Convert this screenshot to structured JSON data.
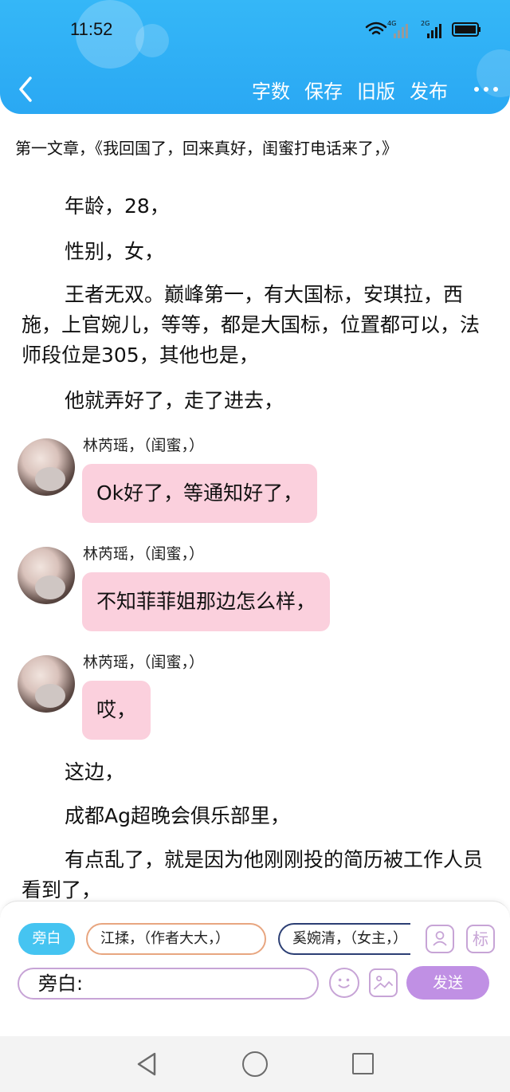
{
  "status": {
    "time": "11:52",
    "net1": "4G",
    "net2": "2G"
  },
  "header": {
    "actions": [
      "字数",
      "保存",
      "旧版",
      "发布"
    ]
  },
  "chapter_title": "第一文章，《我回国了，回来真好，闺蜜打电话来了，》",
  "paragraphs_top": [
    "年龄，28，",
    "性别，女，",
    "王者无双。巅峰第一，有大国标，安琪拉，西施，上官婉儿，等等，都是大国标，位置都可以，法师段位是305，其他也是，",
    "他就弄好了，走了进去，"
  ],
  "messages": [
    {
      "speaker": "林芮瑶，（闺蜜，）",
      "text": "Ok好了，等通知好了，"
    },
    {
      "speaker": "林芮瑶，（闺蜜，）",
      "text": "不知菲菲姐那边怎么样，"
    },
    {
      "speaker": "林芮瑶，（闺蜜，）",
      "text": "哎，"
    }
  ],
  "paragraphs_bottom": [
    "这边，",
    "成都Ag超晚会俱乐部里，",
    "有点乱了，就是因为他刚刚投的简历被工作人员看到了，"
  ],
  "composer": {
    "chips": [
      "旁白",
      "江揉，（作者大大，）",
      "奚婉清，（女主，）"
    ],
    "tag_label": "标",
    "input_prefix": "旁白:",
    "send_label": "发送"
  },
  "colors": {
    "header": "#2aa8f3",
    "bubble": "#fbd0dd",
    "accent": "#c090e4",
    "chip_active": "#45c4f1"
  }
}
